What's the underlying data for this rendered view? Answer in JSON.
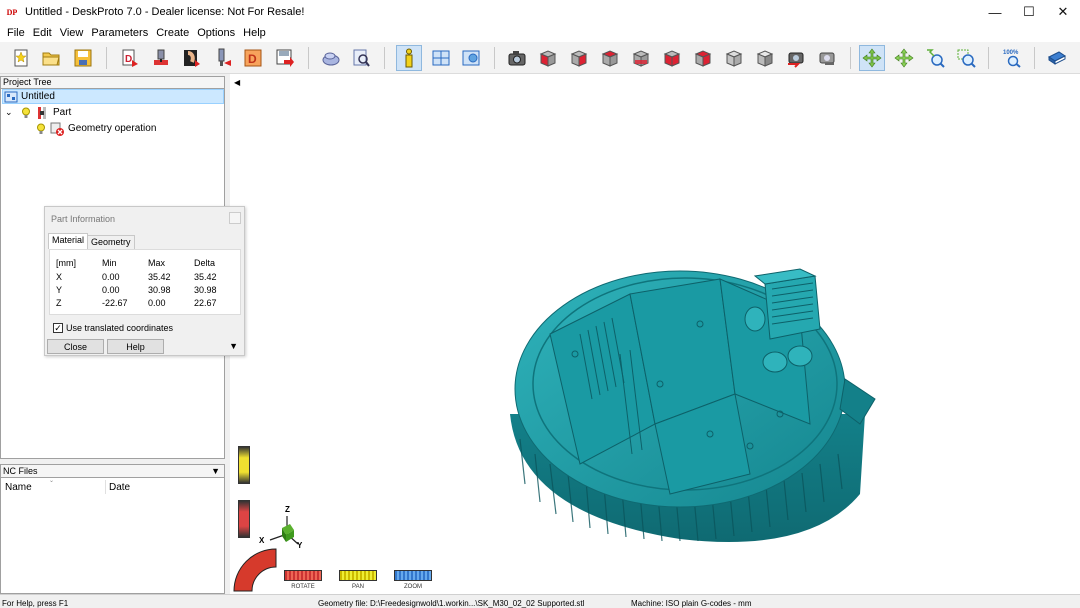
{
  "window": {
    "app_icon_text": "DP",
    "title": "Untitled - DeskProto 7.0 - Dealer license: Not For Resale!",
    "controls": [
      "minimize-icon",
      "maximize-icon",
      "close-icon"
    ]
  },
  "menu": [
    "File",
    "Edit",
    "View",
    "Parameters",
    "Create",
    "Options",
    "Help"
  ],
  "toolbar": {
    "buttons": [
      "new-project-icon",
      "open-project-icon",
      "save-project-icon",
      "load-geometry-icon",
      "machine-icon",
      "drill-icon",
      "tool-icon",
      "d-settings-icon",
      "export-icon",
      "simulation-icon",
      "preview-icon",
      "info-icon",
      "window-layout-icon",
      "view-settings-icon",
      "camera-view-icon",
      "cube-view-1-icon",
      "cube-view-2-icon",
      "cube-view-3-icon",
      "cube-view-4-icon",
      "cube-view-5-icon",
      "cube-view-6-icon",
      "cube-view-7-icon",
      "cube-view-8-icon",
      "rotate-view-icon",
      "reset-view-icon",
      "rotate-mode-icon",
      "pan-mode-icon",
      "zoom-in-icon",
      "zoom-window-icon",
      "zoom-100-icon",
      "help-book-icon"
    ],
    "zoom_label": "100%"
  },
  "project_tree": {
    "header": "Project Tree",
    "root": "Untitled",
    "part": "Part",
    "operation": "Geometry operation"
  },
  "nc_files": {
    "header": "NC Files",
    "columns": [
      "Name",
      "Date"
    ]
  },
  "part_information": {
    "title": "Part Information",
    "tabs": [
      "Material",
      "Geometry"
    ],
    "headers": [
      "[mm]",
      "Min",
      "Max",
      "Delta"
    ],
    "rows": [
      {
        "axis": "X",
        "min": "0.00",
        "max": "35.42",
        "delta": "35.42"
      },
      {
        "axis": "Y",
        "min": "0.00",
        "max": "30.98",
        "delta": "30.98"
      },
      {
        "axis": "Z",
        "min": "-22.67",
        "max": "0.00",
        "delta": "22.67"
      }
    ],
    "checkbox_label": "Use translated coordinates",
    "checkbox_checked": true,
    "buttons": [
      "Close",
      "Help"
    ]
  },
  "viewport": {
    "model_color": "#1a9aa3",
    "axes": {
      "x": "X",
      "y": "Y",
      "z": "Z"
    },
    "controls": {
      "rotate": "ROTATE",
      "pan": "PAN",
      "zoom": "ZOOM"
    }
  },
  "status": {
    "help": "For Help, press F1",
    "geometry_file": "Geometry file: D:\\Freedesignwold\\1.workin...\\SK_M30_02_02 Supported.stl",
    "machine": "Machine: ISO plain G-codes - mm"
  }
}
